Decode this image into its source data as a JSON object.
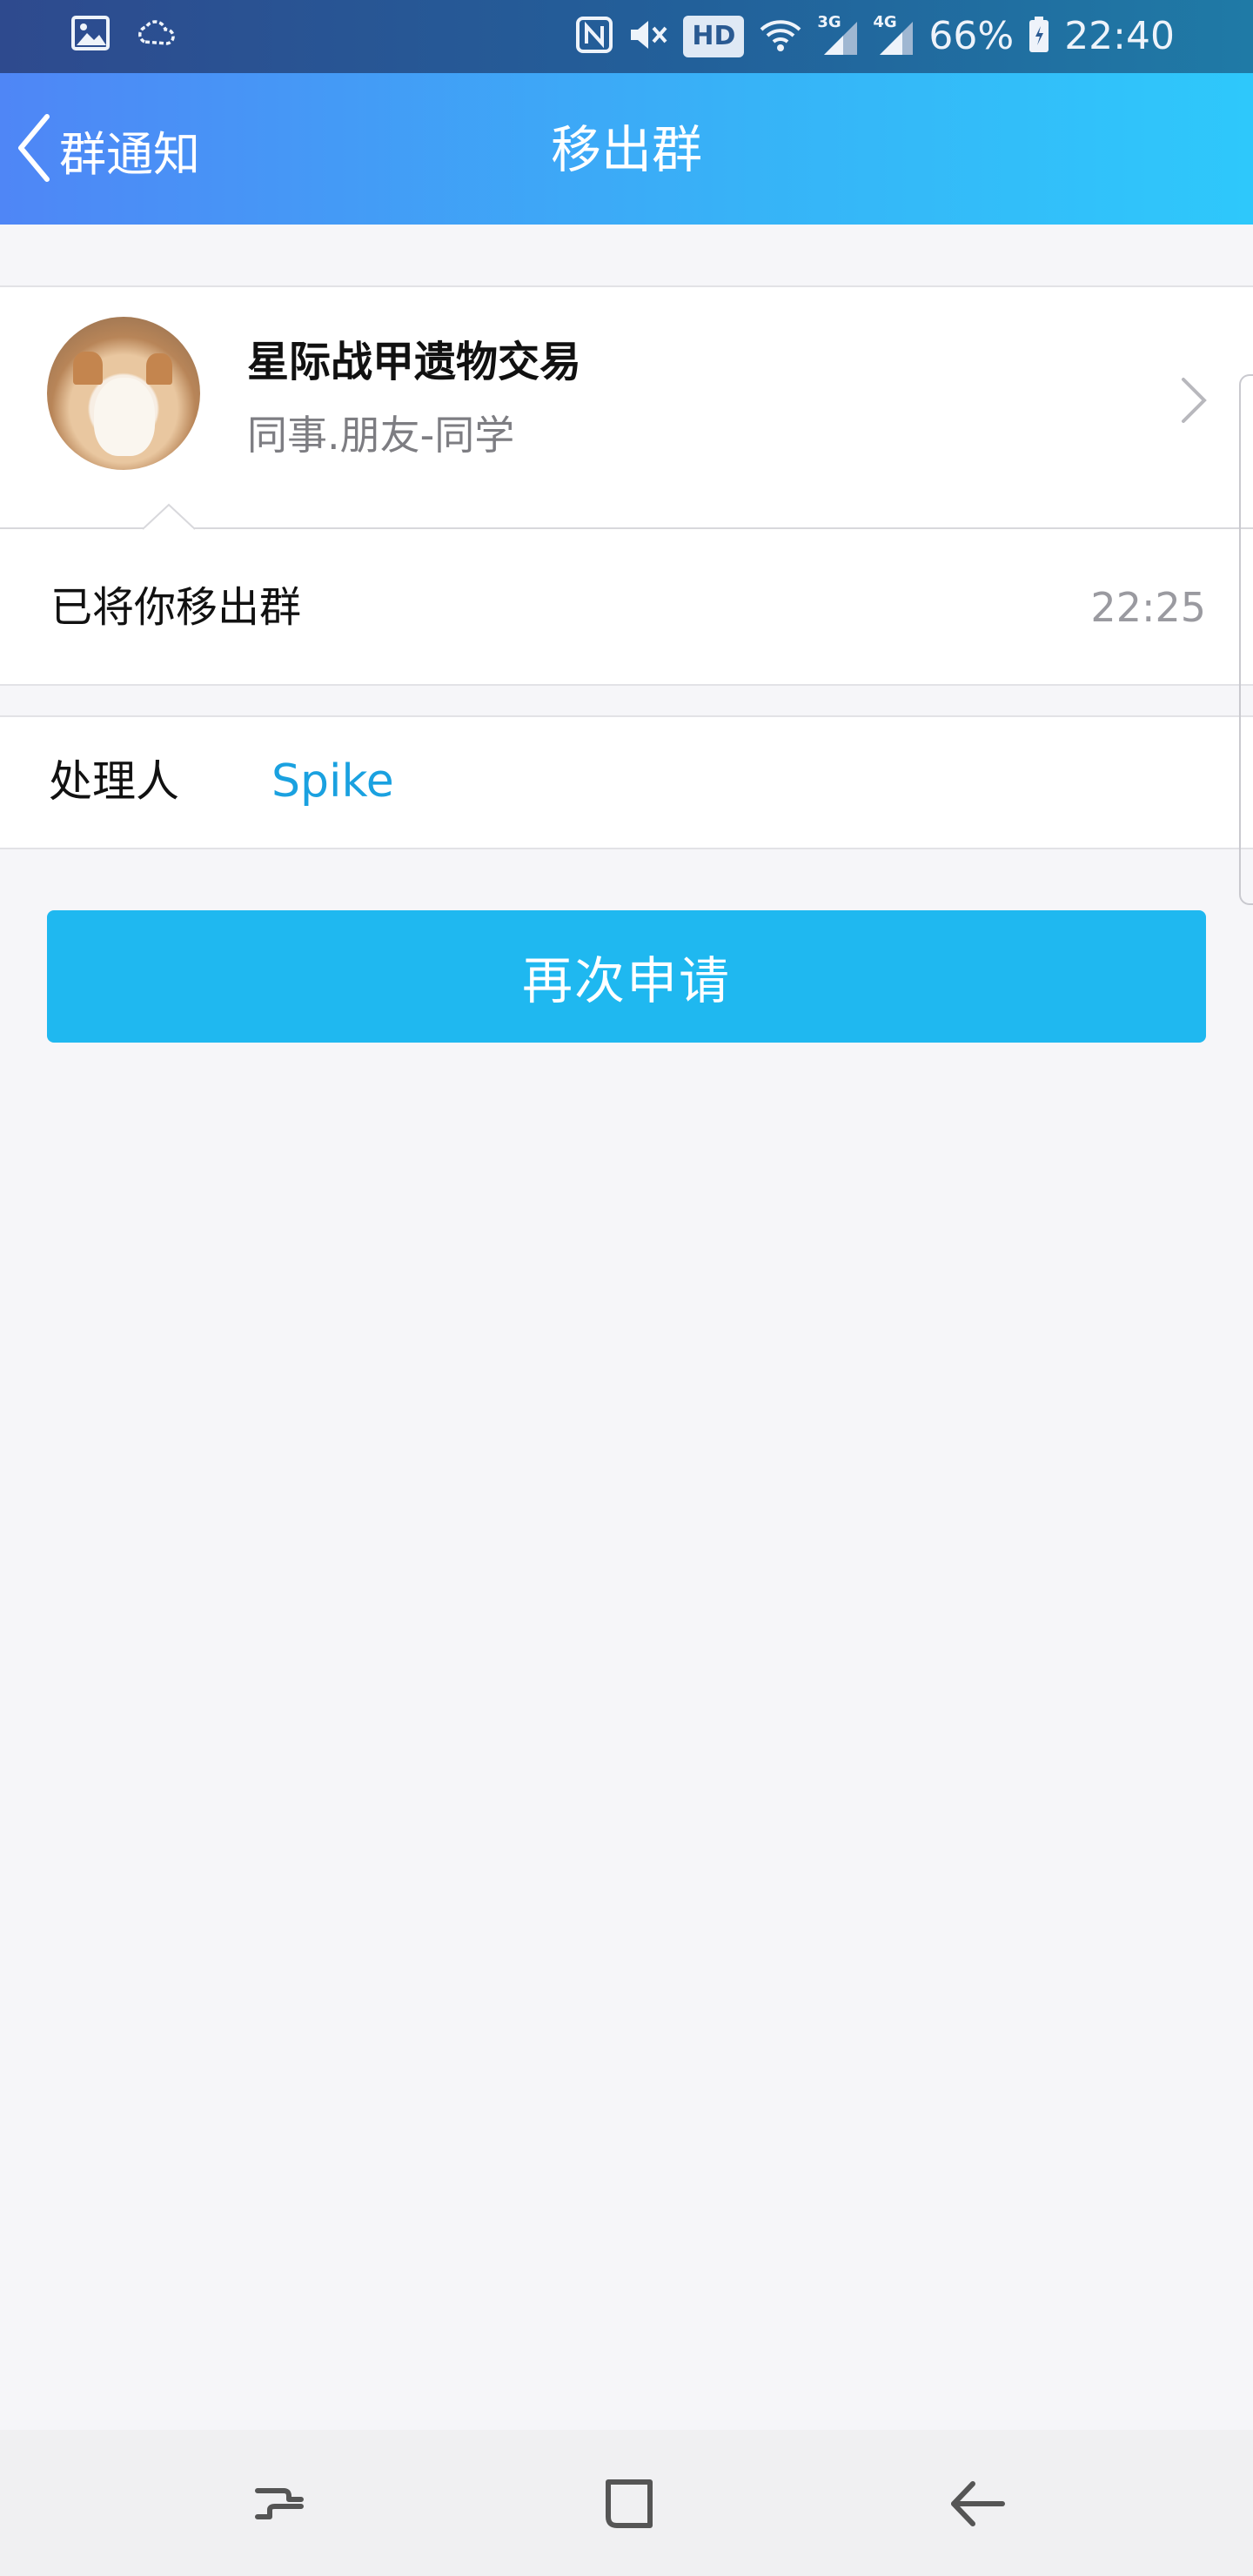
{
  "status_bar": {
    "battery": "66%",
    "time": "22:40",
    "hd_badge": "HD",
    "net_3g": "3G",
    "net_4g": "4G",
    "icons": [
      "image-icon",
      "weather-icon",
      "nfc-icon",
      "mute-icon",
      "wifi-icon",
      "signal-3g-icon",
      "signal-4g-icon",
      "battery-icon"
    ]
  },
  "header": {
    "back_label": "群通知",
    "title": "移出群"
  },
  "group": {
    "name": "星际战甲遗物交易",
    "subtitle": "同事.朋友-同学"
  },
  "event": {
    "text": "已将你移出群",
    "time": "22:25"
  },
  "handler": {
    "label": "处理人",
    "name": "Spike"
  },
  "action": {
    "reapply_label": "再次申请"
  },
  "nav": {
    "icons": [
      "recent-apps-icon",
      "home-icon",
      "back-icon"
    ]
  },
  "colors": {
    "accent": "#1fb8f0",
    "link": "#1aa1e0",
    "header_start": "#4f86f6",
    "header_end": "#2ec8fb"
  }
}
